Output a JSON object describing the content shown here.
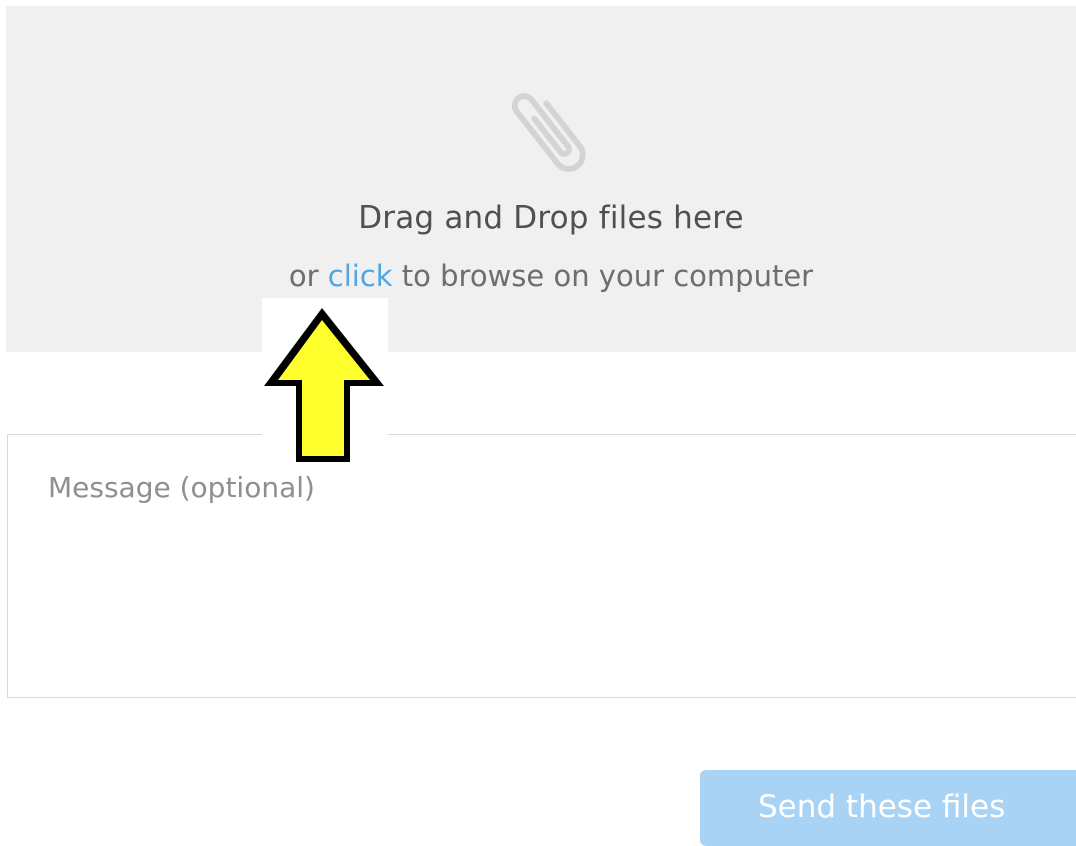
{
  "dropzone": {
    "icon": "paperclip-icon",
    "title": "Drag and Drop files here",
    "subtitle_prefix": "or ",
    "subtitle_link": "click",
    "subtitle_suffix": " to browse on your computer"
  },
  "annotation": {
    "icon": "yellow-up-arrow-icon"
  },
  "message": {
    "placeholder": "Message (optional)",
    "value": ""
  },
  "actions": {
    "send_label": "Send these files"
  },
  "colors": {
    "dropzone_bg": "#f0f0f0",
    "link": "#4fa6e3",
    "send_button_bg": "#a8d3f5",
    "arrow_fill": "#ffff2e"
  }
}
